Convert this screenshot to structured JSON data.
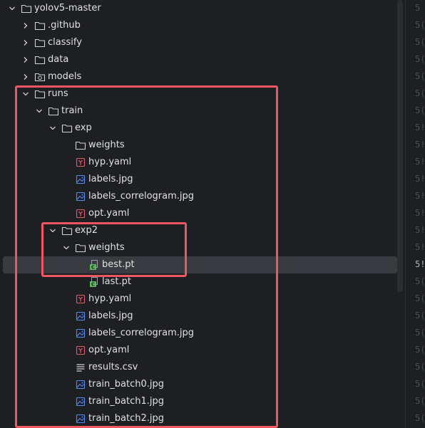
{
  "tree": [
    {
      "label": "yolov5-master",
      "depth": 0,
      "expand": "down",
      "icon": "folder"
    },
    {
      "label": ".github",
      "depth": 1,
      "expand": "right",
      "icon": "folder"
    },
    {
      "label": "classify",
      "depth": 1,
      "expand": "right",
      "icon": "folder"
    },
    {
      "label": "data",
      "depth": 1,
      "expand": "right",
      "icon": "folder"
    },
    {
      "label": "models",
      "depth": 1,
      "expand": "right",
      "icon": "folder-package"
    },
    {
      "label": "runs",
      "depth": 1,
      "expand": "down",
      "icon": "folder"
    },
    {
      "label": "train",
      "depth": 2,
      "expand": "down",
      "icon": "folder"
    },
    {
      "label": "exp",
      "depth": 3,
      "expand": "down",
      "icon": "folder"
    },
    {
      "label": "weights",
      "depth": 4,
      "expand": "none",
      "icon": "folder"
    },
    {
      "label": "hyp.yaml",
      "depth": 4,
      "expand": "none",
      "icon": "yaml"
    },
    {
      "label": "labels.jpg",
      "depth": 4,
      "expand": "none",
      "icon": "image"
    },
    {
      "label": "labels_correlogram.jpg",
      "depth": 4,
      "expand": "none",
      "icon": "image"
    },
    {
      "label": "opt.yaml",
      "depth": 4,
      "expand": "none",
      "icon": "yaml"
    },
    {
      "label": "exp2",
      "depth": 3,
      "expand": "down",
      "icon": "folder"
    },
    {
      "label": "weights",
      "depth": 4,
      "expand": "down",
      "icon": "folder"
    },
    {
      "label": "best.pt",
      "depth": 5,
      "expand": "none",
      "icon": "pt",
      "selected": true
    },
    {
      "label": "last.pt",
      "depth": 5,
      "expand": "none",
      "icon": "pt"
    },
    {
      "label": "hyp.yaml",
      "depth": 4,
      "expand": "none",
      "icon": "yaml"
    },
    {
      "label": "labels.jpg",
      "depth": 4,
      "expand": "none",
      "icon": "image"
    },
    {
      "label": "labels_correlogram.jpg",
      "depth": 4,
      "expand": "none",
      "icon": "image"
    },
    {
      "label": "opt.yaml",
      "depth": 4,
      "expand": "none",
      "icon": "yaml"
    },
    {
      "label": "results.csv",
      "depth": 4,
      "expand": "none",
      "icon": "csv"
    },
    {
      "label": "train_batch0.jpg",
      "depth": 4,
      "expand": "none",
      "icon": "image"
    },
    {
      "label": "train_batch1.jpg",
      "depth": 4,
      "expand": "none",
      "icon": "image"
    },
    {
      "label": "train_batch2.jpg",
      "depth": 4,
      "expand": "none",
      "icon": "image"
    }
  ],
  "gutter_numbers": [
    "5",
    "5(",
    "5(",
    "5(",
    "5(",
    "5(",
    "5(",
    "5!",
    "5!",
    "5!",
    "5!",
    "5!",
    "5!",
    "5!",
    "5!",
    "5!",
    "5(",
    "5(",
    "5(",
    "5(",
    "5(",
    "5(",
    "5(",
    "5(",
    "5("
  ],
  "current_line_index": 15,
  "colors": {
    "background": "#1e1f22",
    "text": "#dfe1e5",
    "selection": "#393b40",
    "highlight_box": "#ec5762",
    "folder_icon": "#ced0d6",
    "yaml_icon": "#e55765",
    "image_icon": "#548af7",
    "pt_icon": "#5fb865"
  }
}
